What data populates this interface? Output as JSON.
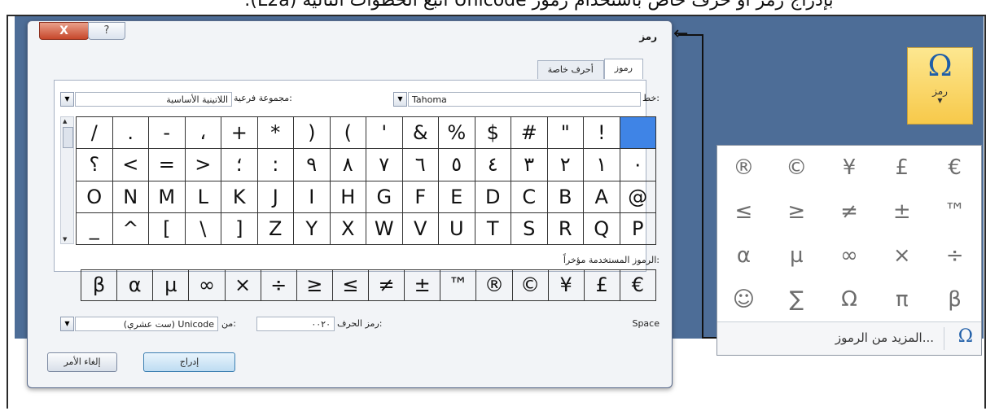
{
  "caption": "بإدراج رمز أو حرف خاص باستخدام رموز Unicode اتبع الخطوات التالية (L2a):",
  "dialog": {
    "title": "رمز",
    "close_label": "X",
    "help_label": "?",
    "tabs": [
      "رموز",
      "أحرف خاصة"
    ],
    "font_label": "خط:",
    "font_value": "Tahoma",
    "subset_label": "مجموعة فرعية:",
    "subset_value": "اللاتينية الأساسية",
    "grid_rows": [
      [
        "",
        "!",
        "\"",
        "#",
        "$",
        "%",
        "&",
        "'",
        ")",
        "(",
        "*",
        "+",
        "،",
        "-",
        ".",
        "/"
      ],
      [
        "٠",
        "١",
        "٢",
        "٣",
        "٤",
        "٥",
        "٦",
        "٧",
        "٨",
        "٩",
        ":",
        "؛",
        "<",
        "=",
        ">",
        "؟"
      ],
      [
        "@",
        "A",
        "B",
        "C",
        "D",
        "E",
        "F",
        "G",
        "H",
        "I",
        "J",
        "K",
        "L",
        "M",
        "N",
        "O"
      ],
      [
        "P",
        "Q",
        "R",
        "S",
        "T",
        "U",
        "V",
        "W",
        "X",
        "Y",
        "Z",
        "[",
        "\\",
        "]",
        "^",
        "_"
      ]
    ],
    "recent_label": "الرموز المستخدمة مؤخراً:",
    "recent": [
      "€",
      "£",
      "¥",
      "©",
      "®",
      "™",
      "±",
      "≠",
      "≥",
      "≤",
      "÷",
      "×",
      "∞",
      "µ",
      "α",
      "β"
    ],
    "char_name": "Space",
    "char_code_label": "رمز الحرف:",
    "char_code_value": "٠٠٢٠",
    "from_label": "من:",
    "from_value": "Unicode (ست عشري)",
    "insert_label": "إدراج",
    "cancel_label": "إلغاء الأمر"
  },
  "ribbon_button": {
    "icon": "omega-icon",
    "glyph": "Ω",
    "label": "رمز",
    "caret": "▼"
  },
  "gallery": {
    "symbols": [
      "€",
      "£",
      "¥",
      "©",
      "®",
      "™",
      "±",
      "≠",
      "≤",
      "≥",
      "÷",
      "×",
      "∞",
      "µ",
      "α",
      "β",
      "π",
      "Ω",
      "∑",
      "☺"
    ],
    "more_icon": "Ω",
    "more_label": "المزيد من الرموز..."
  },
  "colors": {
    "background": "#4d6d97",
    "selected_cell": "#3f84e6",
    "ribbon_button": "#f7c94a",
    "close_button": "#c7472b"
  }
}
